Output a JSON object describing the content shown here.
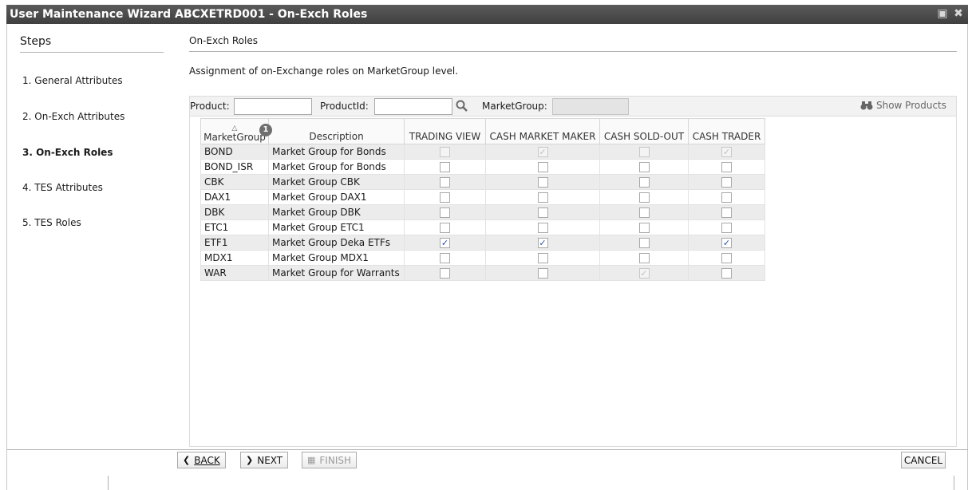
{
  "window": {
    "title": "User Maintenance Wizard ABCXETRD001 - On-Exch Roles",
    "icons": [
      "restore-icon",
      "close-icon"
    ]
  },
  "steps": {
    "heading": "Steps",
    "items": [
      {
        "label": "1. General Attributes",
        "active": false
      },
      {
        "label": "2. On-Exch Attributes",
        "active": false
      },
      {
        "label": "3. On-Exch Roles",
        "active": true
      },
      {
        "label": "4. TES Attributes",
        "active": false
      },
      {
        "label": "5. TES Roles",
        "active": false
      }
    ]
  },
  "section": {
    "title": "On-Exch Roles",
    "description": "Assignment of on-Exchange roles on MarketGroup level."
  },
  "filters": {
    "product_label": "Product:",
    "product_value": "",
    "productid_label": "ProductId:",
    "productid_value": "",
    "marketgroup_label": "MarketGroup:",
    "marketgroup_value": "",
    "show_products_label": "Show Products"
  },
  "grid": {
    "columns": [
      "MarketGroup",
      "Description",
      "TRADING VIEW",
      "CASH MARKET MAKER",
      "CASH SOLD-OUT",
      "CASH TRADER"
    ],
    "sort_badge": "1",
    "rows": [
      {
        "group": "BOND",
        "description": "Market Group for Bonds",
        "trading_view": false,
        "cash_market_maker": true,
        "cash_sold_out": false,
        "cash_trader": true,
        "readonly": [
          true,
          true,
          true,
          true
        ]
      },
      {
        "group": "BOND_ISR",
        "description": "Market Group for Bonds",
        "trading_view": false,
        "cash_market_maker": false,
        "cash_sold_out": false,
        "cash_trader": false,
        "readonly": [
          false,
          false,
          false,
          false
        ]
      },
      {
        "group": "CBK",
        "description": "Market Group CBK",
        "trading_view": false,
        "cash_market_maker": false,
        "cash_sold_out": false,
        "cash_trader": false,
        "readonly": [
          false,
          false,
          false,
          false
        ]
      },
      {
        "group": "DAX1",
        "description": "Market Group DAX1",
        "trading_view": false,
        "cash_market_maker": false,
        "cash_sold_out": false,
        "cash_trader": false,
        "readonly": [
          false,
          false,
          false,
          false
        ]
      },
      {
        "group": "DBK",
        "description": "Market Group DBK",
        "trading_view": false,
        "cash_market_maker": false,
        "cash_sold_out": false,
        "cash_trader": false,
        "readonly": [
          false,
          false,
          false,
          false
        ]
      },
      {
        "group": "ETC1",
        "description": "Market Group ETC1",
        "trading_view": false,
        "cash_market_maker": false,
        "cash_sold_out": false,
        "cash_trader": false,
        "readonly": [
          false,
          false,
          false,
          false
        ]
      },
      {
        "group": "ETF1",
        "description": "Market Group Deka ETFs",
        "trading_view": true,
        "cash_market_maker": true,
        "cash_sold_out": false,
        "cash_trader": true,
        "readonly": [
          false,
          false,
          false,
          false
        ]
      },
      {
        "group": "MDX1",
        "description": "Market Group MDX1",
        "trading_view": false,
        "cash_market_maker": false,
        "cash_sold_out": false,
        "cash_trader": false,
        "readonly": [
          false,
          false,
          false,
          false
        ]
      },
      {
        "group": "WAR",
        "description": "Market Group for Warrants",
        "trading_view": false,
        "cash_market_maker": false,
        "cash_sold_out": true,
        "cash_trader": false,
        "readonly": [
          false,
          false,
          true,
          false
        ]
      }
    ]
  },
  "buttons": {
    "back": "BACK",
    "next": "NEXT",
    "finish": "FINISH",
    "cancel": "CANCEL"
  }
}
